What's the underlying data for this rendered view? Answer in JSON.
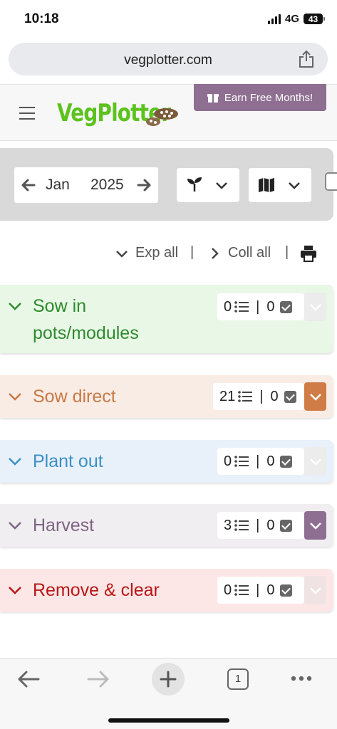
{
  "status_bar": {
    "time": "10:18",
    "network": "4G",
    "battery": "43"
  },
  "browser": {
    "url": "vegplotter.com"
  },
  "header": {
    "logo_text": "VegPlotter",
    "earn_label": "Earn Free Months!"
  },
  "toolbar": {
    "month": "Jan",
    "year": "2025"
  },
  "controls": {
    "expand_label": "Exp all",
    "separator": "|",
    "collapse_label": "Coll all"
  },
  "sections": [
    {
      "title": "Sow in pots/modules",
      "count": "0",
      "done": "0",
      "color": "#2e8b2e",
      "bg": "#e9f7e6",
      "toggle_color": "#ececec"
    },
    {
      "title": "Sow direct",
      "count": "21",
      "done": "0",
      "color": "#c77a46",
      "bg": "#f9ece5",
      "toggle_color": "#cf7c46"
    },
    {
      "title": "Plant out",
      "count": "0",
      "done": "0",
      "color": "#3a8fc7",
      "bg": "#e8f0fa",
      "toggle_color": "#ececec"
    },
    {
      "title": "Harvest",
      "count": "3",
      "done": "0",
      "color": "#7e6482",
      "bg": "#f1eef2",
      "toggle_color": "#8e6f91"
    },
    {
      "title": "Remove & clear",
      "count": "0",
      "done": "0",
      "color": "#b81616",
      "bg": "#fde6e6",
      "toggle_color": "#f0e3e3"
    }
  ],
  "bottom_nav": {
    "tab_count": "1"
  }
}
